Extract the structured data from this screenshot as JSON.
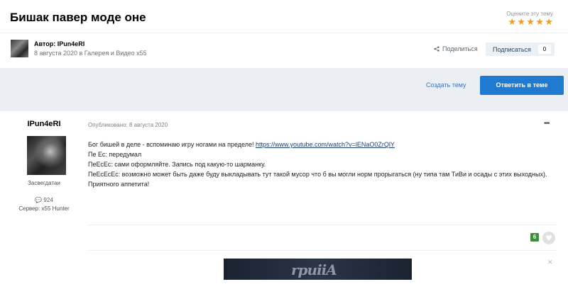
{
  "topic": {
    "title": "Бишак павер моде оне",
    "rate_label": "Оцените эту тему",
    "rating": 5,
    "author_line": "Автор: IPun4eRI",
    "date_line": "8 августа 2020 в Галерея и Видео x55",
    "share_label": "Поделиться",
    "follow_label": "Подписаться",
    "follow_count": "0"
  },
  "actions": {
    "create_topic": "Создать тему",
    "reply": "Ответить в теме"
  },
  "post": {
    "author": "IPun4eRI",
    "group": "Засвегдатаи",
    "post_count": "924",
    "server": "Сервер: x55 Hunter",
    "published": "Опубликовано: 8 августа 2020",
    "menu": "•••",
    "lines": {
      "l1_text": "Бог бишей в деле - вспоминаю игру ногами на пределе! ",
      "l1_link": "https://www.youtube.com/watch?v=lENaO0ZrQlY",
      "l2": "Пе Ес: передумал",
      "l3": "ПеЕсЕс: сами оформляйте. Запись под какую-то шарманку.",
      "l4": "ПеЕсЕсЕс: возможно может быть даже буду выкладывать тут такой мусор что б вы могли норм прорыгаться (ну типа там ТиВи и осады с этих выходных).",
      "l5": "Приятного аппетита!"
    },
    "reaction_count": "6"
  },
  "signature": {
    "text": "rpuiiA"
  },
  "colors": {
    "accent": "#1f7ad1",
    "star": "#f59c1a",
    "reaction": "#3b8f3e"
  }
}
